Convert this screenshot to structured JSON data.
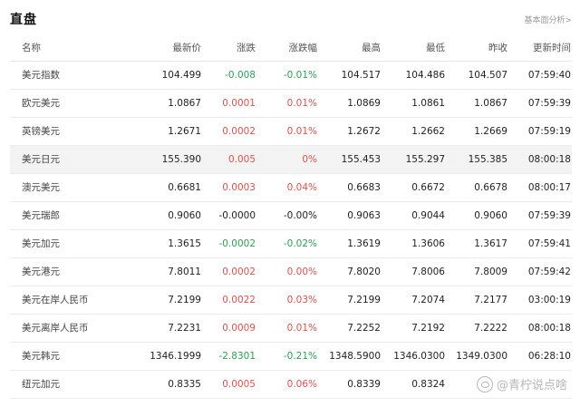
{
  "header": {
    "title": "直盘",
    "more_link": "基本面分析>"
  },
  "table": {
    "columns": [
      "名称",
      "最新价",
      "涨跌",
      "涨跌幅",
      "最高",
      "最低",
      "昨收",
      "更新时间"
    ],
    "rows": [
      {
        "name": "美元指数",
        "last": "104.499",
        "change": "-0.008",
        "pct": "-0.01%",
        "high": "104.517",
        "low": "104.486",
        "prev": "104.507",
        "time": "07:59:40",
        "dir": "down"
      },
      {
        "name": "欧元美元",
        "last": "1.0867",
        "change": "0.0001",
        "pct": "0.01%",
        "high": "1.0869",
        "low": "1.0861",
        "prev": "1.0867",
        "time": "07:59:39",
        "dir": "up"
      },
      {
        "name": "英镑美元",
        "last": "1.2671",
        "change": "0.0002",
        "pct": "0.01%",
        "high": "1.2672",
        "low": "1.2662",
        "prev": "1.2669",
        "time": "07:59:19",
        "dir": "up"
      },
      {
        "name": "美元日元",
        "last": "155.390",
        "change": "0.005",
        "pct": "0%",
        "high": "155.453",
        "low": "155.297",
        "prev": "155.385",
        "time": "08:00:18",
        "dir": "up"
      },
      {
        "name": "澳元美元",
        "last": "0.6681",
        "change": "0.0003",
        "pct": "0.04%",
        "high": "0.6683",
        "low": "0.6672",
        "prev": "0.6678",
        "time": "08:00:17",
        "dir": "up"
      },
      {
        "name": "美元瑞郎",
        "last": "0.9060",
        "change": "-0.0000",
        "pct": "-0.00%",
        "high": "0.9063",
        "low": "0.9044",
        "prev": "0.9060",
        "time": "07:59:39",
        "dir": "flat"
      },
      {
        "name": "美元加元",
        "last": "1.3615",
        "change": "-0.0002",
        "pct": "-0.02%",
        "high": "1.3619",
        "low": "1.3606",
        "prev": "1.3617",
        "time": "07:59:41",
        "dir": "down"
      },
      {
        "name": "美元港元",
        "last": "7.8011",
        "change": "0.0002",
        "pct": "0.00%",
        "high": "7.8020",
        "low": "7.8006",
        "prev": "7.8009",
        "time": "07:59:42",
        "dir": "up"
      },
      {
        "name": "美元在岸人民币",
        "last": "7.2199",
        "change": "0.0022",
        "pct": "0.03%",
        "high": "7.2199",
        "low": "7.2074",
        "prev": "7.2177",
        "time": "03:00:19",
        "dir": "up"
      },
      {
        "name": "美元离岸人民币",
        "last": "7.2231",
        "change": "0.0009",
        "pct": "0.01%",
        "high": "7.2252",
        "low": "7.2192",
        "prev": "7.2222",
        "time": "08:00:18",
        "dir": "up"
      },
      {
        "name": "美元韩元",
        "last": "1346.1999",
        "change": "-2.8301",
        "pct": "-0.21%",
        "high": "1348.5900",
        "low": "1346.0300",
        "prev": "1349.0300",
        "time": "06:28:10",
        "dir": "down"
      },
      {
        "name": "纽元加元",
        "last": "0.8335",
        "change": "0.0005",
        "pct": "0.06%",
        "high": "0.8339",
        "low": "0.8324",
        "prev": "",
        "time": "",
        "dir": "up"
      }
    ]
  },
  "colors": {
    "up": "#d9534f",
    "down": "#2e9e55",
    "highlight_row": "#f3f3f3"
  },
  "watermark": {
    "text": "@青柠说点啥",
    "icon": "logo-icon"
  }
}
